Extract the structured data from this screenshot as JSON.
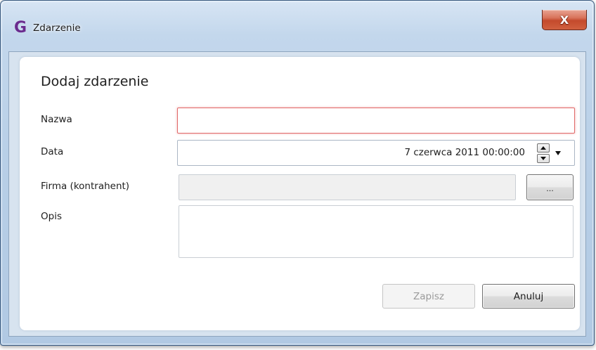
{
  "window": {
    "title": "Zdarzenie",
    "app_icon_glyph": "G",
    "app_icon_color": "#6a2b8e",
    "close_glyph": "X"
  },
  "form": {
    "heading": "Dodaj zdarzenie",
    "name_label": "Nazwa",
    "name_value": "",
    "date_label": "Data",
    "date_value": "7 czerwca 2011 00:00:00",
    "company_label": "Firma (kontrahent)",
    "company_value": "",
    "browse_label": "...",
    "description_label": "Opis",
    "description_value": ""
  },
  "buttons": {
    "save_label": "Zapisz",
    "save_enabled": false,
    "cancel_label": "Anuluj"
  },
  "colors": {
    "validation_error_border": "#e06a6a",
    "disabled_text": "#9a9a9a"
  },
  "icons": {
    "close": "close-icon",
    "spin_up": "spin-up-icon",
    "spin_down": "spin-down-icon",
    "dropdown": "chevron-down-icon"
  }
}
